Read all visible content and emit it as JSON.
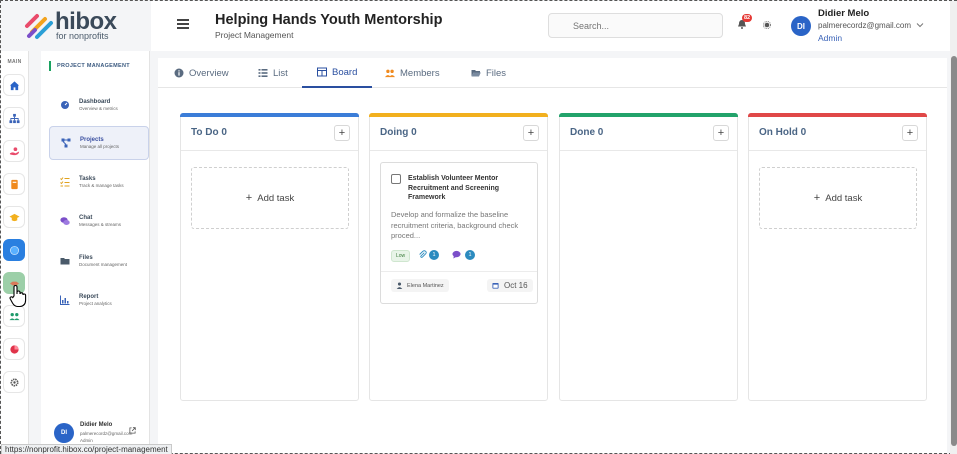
{
  "brand": {
    "name": "hibox",
    "tagline": "for nonprofits"
  },
  "header": {
    "title": "Helping Hands Youth Mentorship",
    "subtitle": "Project Management",
    "search_placeholder": "Search...",
    "notification_count": "82",
    "user": {
      "initials": "DI",
      "name": "Didier Melo",
      "email": "palmerecordz@gmail.com",
      "role": "Admin"
    }
  },
  "rail": {
    "label": "MAIN"
  },
  "sidebar": {
    "section_title": "PROJECT MANAGEMENT",
    "items": [
      {
        "label": "Dashboard",
        "sub": "Overview & metrics"
      },
      {
        "label": "Projects",
        "sub": "Manage all projects"
      },
      {
        "label": "Tasks",
        "sub": "Track & manage tasks"
      },
      {
        "label": "Chat",
        "sub": "Messages & streams"
      },
      {
        "label": "Files",
        "sub": "Document management"
      },
      {
        "label": "Report",
        "sub": "Project analytics"
      }
    ],
    "user": {
      "initials": "DI",
      "name": "Didier Melo",
      "email": "palmerecordz@gmail.com",
      "role": "Admin"
    }
  },
  "tabs": [
    {
      "label": "Overview"
    },
    {
      "label": "List"
    },
    {
      "label": "Board"
    },
    {
      "label": "Members"
    },
    {
      "label": "Files"
    }
  ],
  "board": {
    "add_task_label": "Add task",
    "columns": [
      {
        "title": "To Do 0",
        "color": "#3b7dd8"
      },
      {
        "title": "Doing 0",
        "color": "#f2b01e"
      },
      {
        "title": "Done 0",
        "color": "#22a36b"
      },
      {
        "title": "On Hold 0",
        "color": "#e04848"
      }
    ],
    "card": {
      "title": "Establish Volunteer Mentor Recruitment and Screening Framework",
      "description": "Develop and formalize the baseline recruitment criteria, background check proced...",
      "priority": "Low",
      "attachments": "1",
      "comments": "1",
      "assignee": "Elena Martinez",
      "due": "Oct 16"
    }
  },
  "status_url": "https://nonprofit.hibox.co/project-management"
}
